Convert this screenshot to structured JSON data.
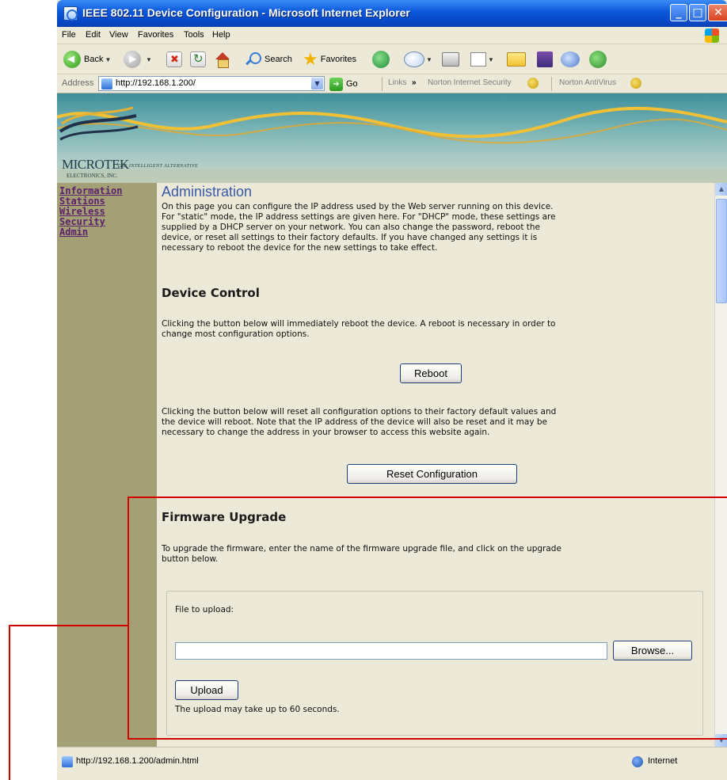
{
  "window": {
    "title": "IEEE 802.11 Device Configuration - Microsoft Internet Explorer",
    "min_glyph": "_",
    "max_glyph": "□",
    "close_glyph": "✕"
  },
  "menubar": {
    "items": [
      "File",
      "Edit",
      "View",
      "Favorites",
      "Tools",
      "Help"
    ]
  },
  "toolbar": {
    "back_label": "Back",
    "search_label": "Search",
    "favorites_label": "Favorites"
  },
  "addressbar": {
    "label": "Address",
    "url": "http://192.168.1.200/",
    "go_label": "Go",
    "links_label": "Links",
    "chevron": "»",
    "norton_security": "Norton Internet Security",
    "norton_antivirus": "Norton AntiVirus"
  },
  "banner": {
    "logo": "MICROTEK",
    "logo_sub": "ELECTRONICS, INC.",
    "tagline": "THE INTELLIGENT ALTERNATIVE"
  },
  "sidebar": {
    "items": [
      "Information",
      "Stations",
      "Wireless",
      "Security",
      "Admin"
    ]
  },
  "content": {
    "title": "Administration",
    "intro": "On this page you can configure the IP address used by the Web server running on this device.\nFor \"static\" mode, the IP address settings are given here. For \"DHCP\" mode, these settings are\nsupplied by a DHCP server on your network. You can also change the password, reboot the\ndevice, or reset all settings to their factory defaults. If you have changed any settings it is\nnecessary to reboot the device for the new settings to take effect.",
    "device_control": {
      "heading": "Device Control",
      "reboot_text": "Clicking the button below will immediately reboot the device. A reboot is necessary in order to\nchange most configuration options.",
      "reboot_button": "Reboot",
      "reset_text": "Clicking the button below will reset all configuration options to their factory default values and\nthe device will reboot. Note that the IP address of the device will also be reset and it may be\nnecessary to change the address in your browser to access this website again.",
      "reset_button": "Reset Configuration"
    },
    "firmware": {
      "heading": "Firmware Upgrade",
      "text": "To upgrade the firmware, enter the name of the firmware upgrade file, and click on the upgrade\nbutton below.",
      "file_label": "File to upload:",
      "file_value": "",
      "browse_button": "Browse...",
      "upload_button": "Upload",
      "note": "The upload may take up to 60 seconds."
    }
  },
  "statusbar": {
    "text": "http://192.168.1.200/admin.html",
    "zone": "Internet"
  },
  "colors": {
    "sidebar_bg": "#a3a075",
    "sidebar_link": "#5c1f6b",
    "title_blue": "#3a5aa8",
    "callout_red": "#d40000"
  }
}
